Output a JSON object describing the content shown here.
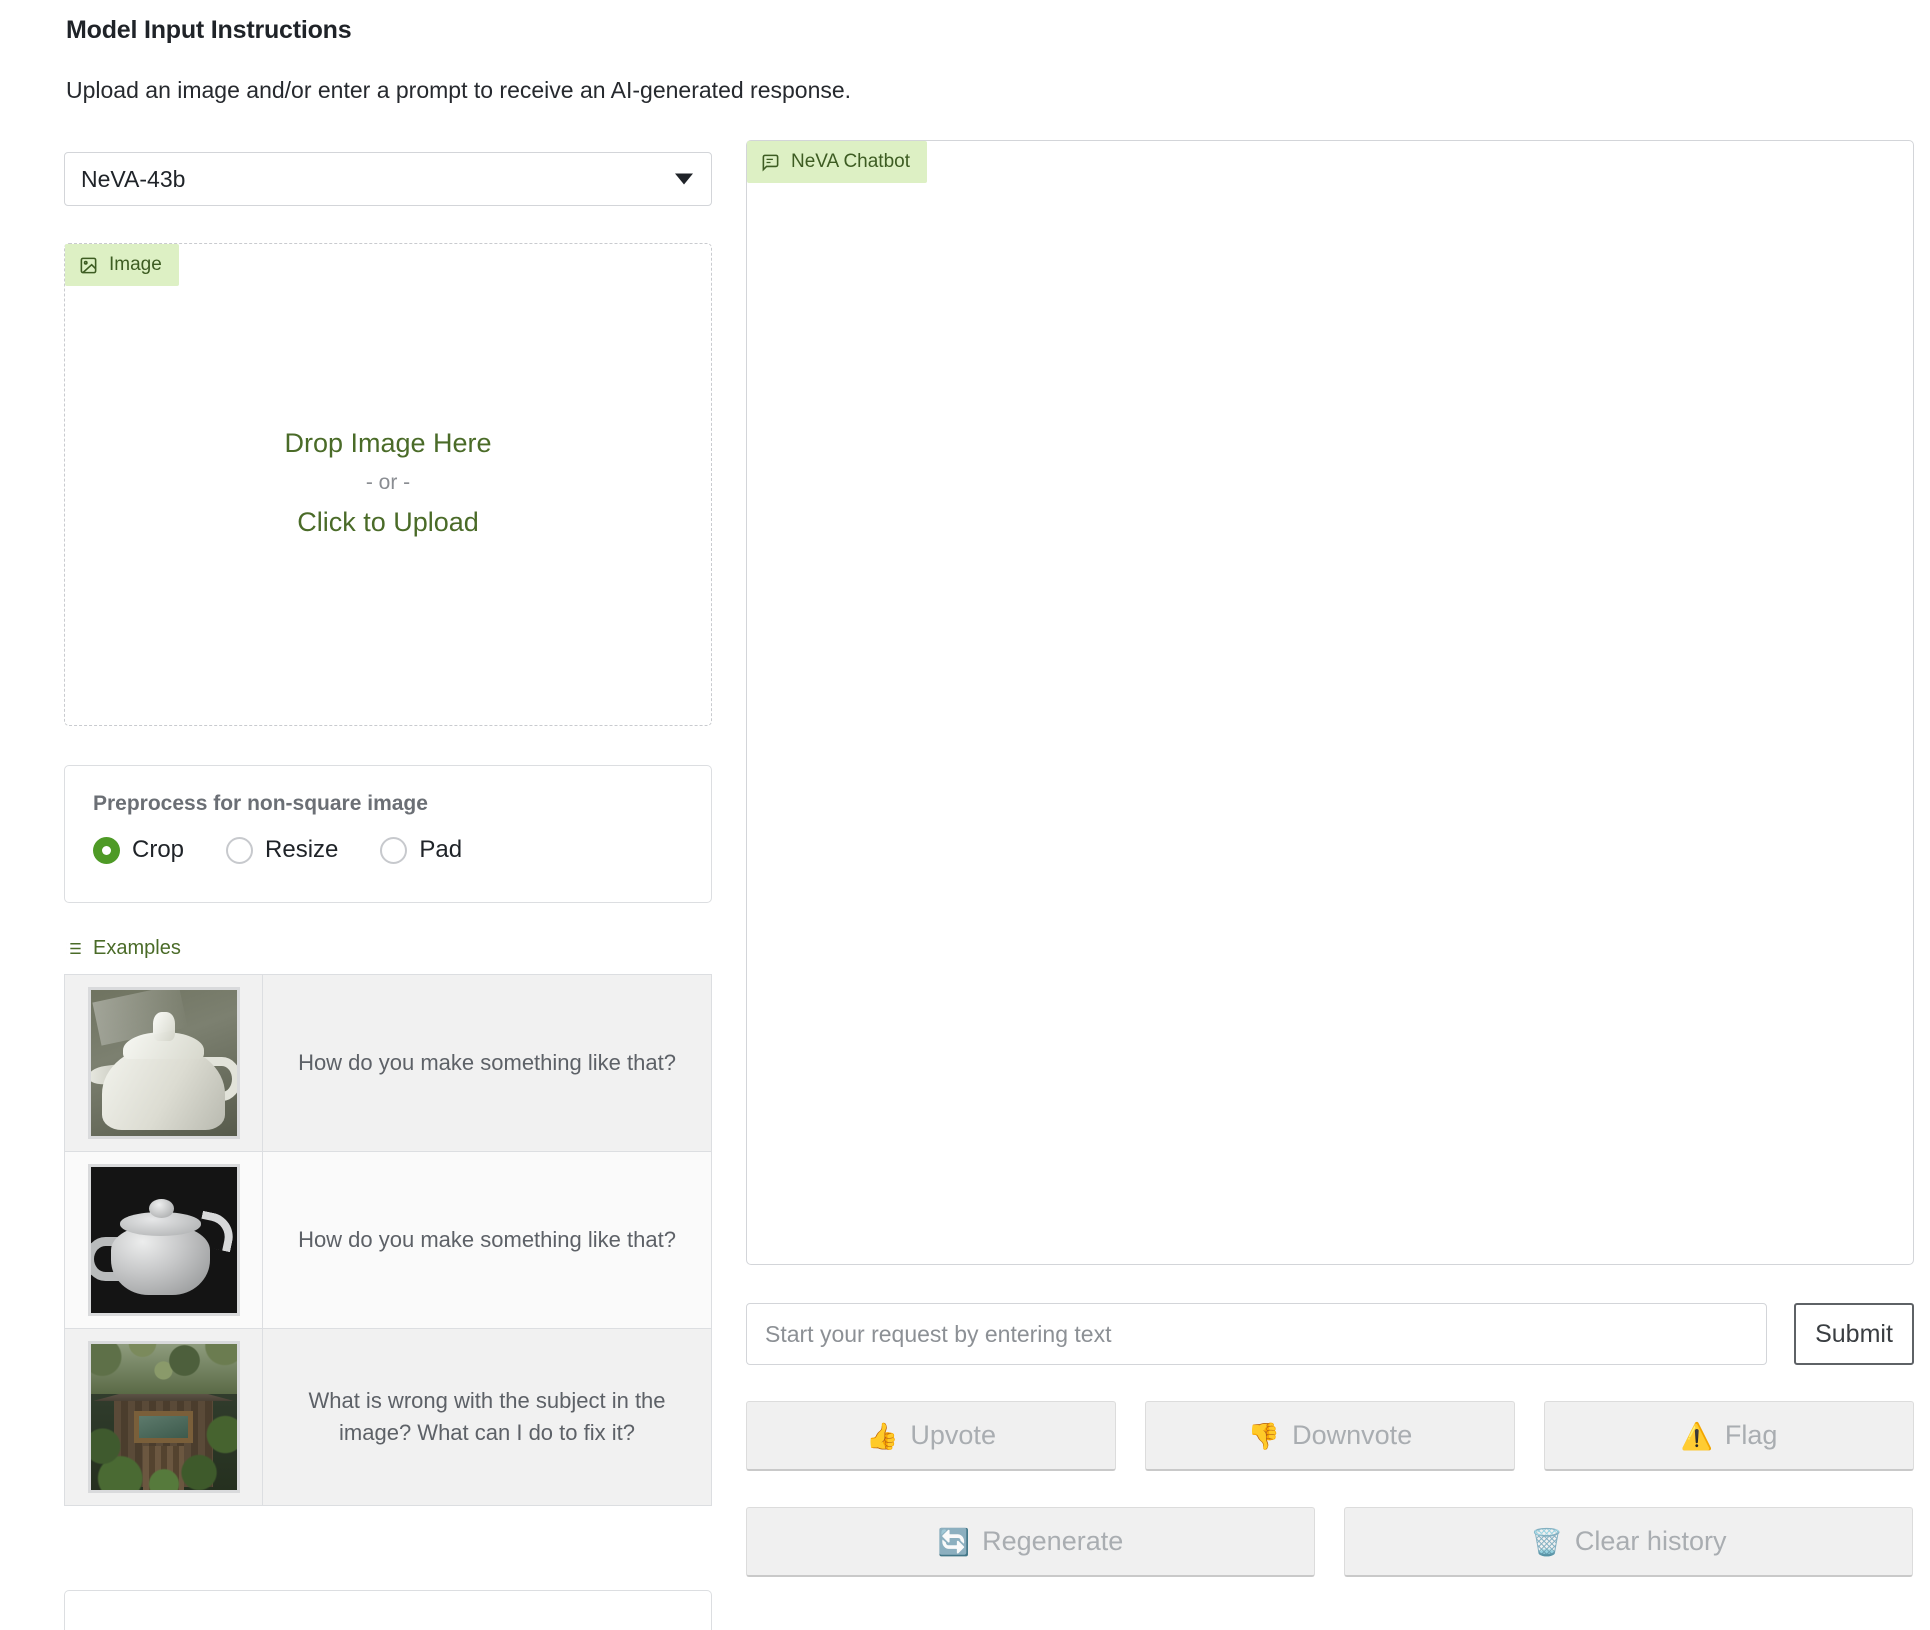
{
  "header": {
    "title": "Model Input Instructions",
    "subtitle": "Upload an image and/or enter a prompt to receive an AI-generated response."
  },
  "model_select": {
    "value": "NeVA-43b",
    "icon": "chevron-down-icon"
  },
  "image_upload": {
    "tab_label": "Image",
    "tab_icon": "image-icon",
    "drop_text": "Drop Image Here",
    "or_text": "- or -",
    "click_text": "Click to Upload"
  },
  "preprocess": {
    "label": "Preprocess for non-square image",
    "options": [
      {
        "label": "Crop",
        "selected": true
      },
      {
        "label": "Resize",
        "selected": false
      },
      {
        "label": "Pad",
        "selected": false
      }
    ]
  },
  "examples": {
    "label": "Examples",
    "icon": "list-icon",
    "rows": [
      {
        "thumb": "white-ceramic-teapot-photo",
        "prompt": "How do you make something like that?"
      },
      {
        "thumb": "3d-rendered-teapot-dark-background",
        "prompt": "How do you make something like that?"
      },
      {
        "thumb": "overgrown-wooden-shed-photo",
        "prompt": "What is wrong with the subject in the image? What can I do to fix it?"
      }
    ]
  },
  "chat": {
    "tab_label": "NeVA Chatbot",
    "tab_icon": "chat-bubble-icon",
    "messages": []
  },
  "prompt_input": {
    "placeholder": "Start your request by entering text",
    "value": ""
  },
  "submit": {
    "label": "Submit"
  },
  "feedback_buttons": [
    {
      "label": "Upvote",
      "icon": "thumbs-up-icon",
      "glyph": "👍"
    },
    {
      "label": "Downvote",
      "icon": "thumbs-down-icon",
      "glyph": "👎"
    },
    {
      "label": "Flag",
      "icon": "warning-icon",
      "glyph": "⚠️"
    }
  ],
  "action_buttons": [
    {
      "label": "Regenerate",
      "icon": "refresh-icon",
      "glyph": "🔄"
    },
    {
      "label": "Clear history",
      "icon": "trash-icon",
      "glyph": "🗑️"
    }
  ],
  "colors": {
    "accent_green": "#4a6b28",
    "chip_bg": "#ddf0c4",
    "radio_selected": "#4e9a26",
    "border": "#d3d5d9",
    "muted_text": "#8c9095"
  }
}
